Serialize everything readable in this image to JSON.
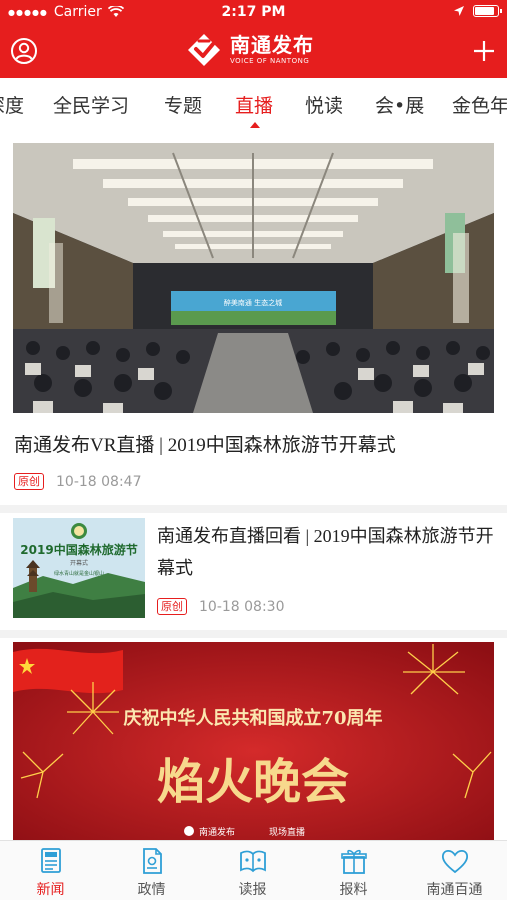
{
  "status_bar": {
    "carrier": "Carrier",
    "time": "2:17 PM",
    "battery_level": 0.9
  },
  "header": {
    "logo_cn": "南通发布",
    "logo_en": "VOICE OF NANTONG",
    "brand_color": "#e61e1e"
  },
  "tabs": [
    {
      "label": "深度",
      "active": false
    },
    {
      "label": "全民学习",
      "active": false
    },
    {
      "label": "专题",
      "active": false
    },
    {
      "label": "直播",
      "active": true
    },
    {
      "label": "悦读",
      "active": false
    },
    {
      "label": "会•展",
      "active": false
    },
    {
      "label": "金色年",
      "active": false
    }
  ],
  "feed": [
    {
      "title": "南通发布VR直播 | 2019中国森林旅游节开幕式",
      "badge": "原创",
      "time": "10-18 08:47",
      "image_screen_text": "醉美南通 生态之城"
    },
    {
      "title": "南通发布直播回看 | 2019中国森林旅游节开幕式",
      "badge": "原创",
      "time": "10-18 08:30",
      "image_title": "2019中国森林旅游节",
      "image_subtitle": "开幕式",
      "image_slogan": "绿水青山就是金山银山"
    },
    {
      "image_headline": "庆祝中华人民共和国成立70周年",
      "image_big_text": "焰火晚会",
      "image_footer_brand": "南通发布",
      "image_footer_tag": "现场直播"
    }
  ],
  "bottom_tabs": [
    {
      "label": "新闻",
      "icon": "news-icon",
      "active": true
    },
    {
      "label": "政情",
      "icon": "document-icon",
      "active": false
    },
    {
      "label": "读报",
      "icon": "newspaper-reader-icon",
      "active": false
    },
    {
      "label": "报料",
      "icon": "gift-box-icon",
      "active": false
    },
    {
      "label": "南通百通",
      "icon": "heart-icon",
      "active": false
    }
  ]
}
